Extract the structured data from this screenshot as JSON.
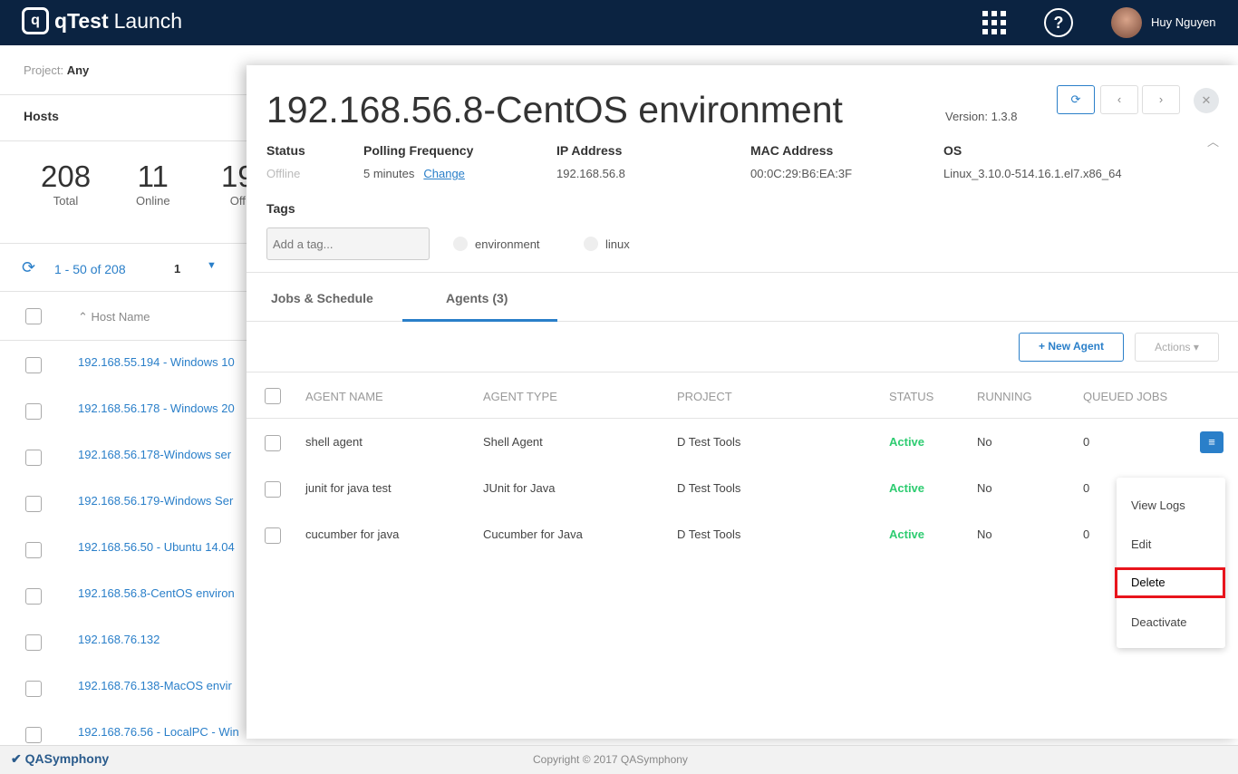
{
  "header": {
    "app_name": "qTest",
    "app_suffix": "Launch",
    "user": "Huy Nguyen",
    "icons": [
      "apps-grid-icon",
      "help-icon",
      "avatar"
    ]
  },
  "left": {
    "project_label": "Project:",
    "project_value": "Any",
    "hosts_title": "Hosts",
    "stats": [
      {
        "n": "208",
        "l": "Total"
      },
      {
        "n": "11",
        "l": "Online"
      },
      {
        "n": "19",
        "l": "Off"
      }
    ],
    "range": "1 - 50 of 208",
    "page": "1",
    "host_name_header": "Host Name",
    "hosts": [
      "192.168.55.194 - Windows 10",
      "192.168.56.178 - Windows 20",
      "192.168.56.178-Windows ser",
      "192.168.56.179-Windows Ser",
      "192.168.56.50 - Ubuntu 14.04",
      "192.168.56.8-CentOS environ",
      "192.168.76.132",
      "192.168.76.138-MacOS envir",
      "192.168.76.56 - LocalPC - Win"
    ]
  },
  "panel": {
    "title": "192.168.56.8-CentOS environment",
    "version": "Version: 1.3.8",
    "fields": {
      "status_k": "Status",
      "status_v": "Offline",
      "poll_k": "Polling Frequency",
      "poll_v": "5 minutes",
      "poll_link": "Change",
      "ip_k": "IP Address",
      "ip_v": "192.168.56.8",
      "mac_k": "MAC Address",
      "mac_v": "00:0C:29:B6:EA:3F",
      "os_k": "OS",
      "os_v": "Linux_3.10.0-514.16.1.el7.x86_64"
    },
    "tags_label": "Tags",
    "tag_placeholder": "Add a tag...",
    "tags": [
      "environment",
      "linux"
    ],
    "tabs": [
      "Jobs & Schedule",
      "Agents (3)"
    ],
    "new_agent": "+ New Agent",
    "actions": "Actions ▾",
    "columns": [
      "AGENT NAME",
      "AGENT TYPE",
      "PROJECT",
      "STATUS",
      "RUNNING",
      "QUEUED JOBS"
    ],
    "agents": [
      {
        "name": "shell agent",
        "type": "Shell Agent",
        "project": "D Test Tools",
        "status": "Active",
        "running": "No",
        "queued": "0"
      },
      {
        "name": "junit for java test",
        "type": "JUnit for Java",
        "project": "D Test Tools",
        "status": "Active",
        "running": "No",
        "queued": "0"
      },
      {
        "name": "cucumber for java",
        "type": "Cucumber for Java",
        "project": "D Test Tools",
        "status": "Active",
        "running": "No",
        "queued": "0"
      }
    ],
    "menu": [
      "View Logs",
      "Edit",
      "Delete",
      "Deactivate"
    ]
  },
  "footer": {
    "brand": "QASymphony",
    "copyright": "Copyright © 2017 QASymphony"
  },
  "colors": {
    "topbar": "#0b2341",
    "accent": "#2a7fc9",
    "active": "#2ecc71",
    "highlight": "#e8141c"
  }
}
